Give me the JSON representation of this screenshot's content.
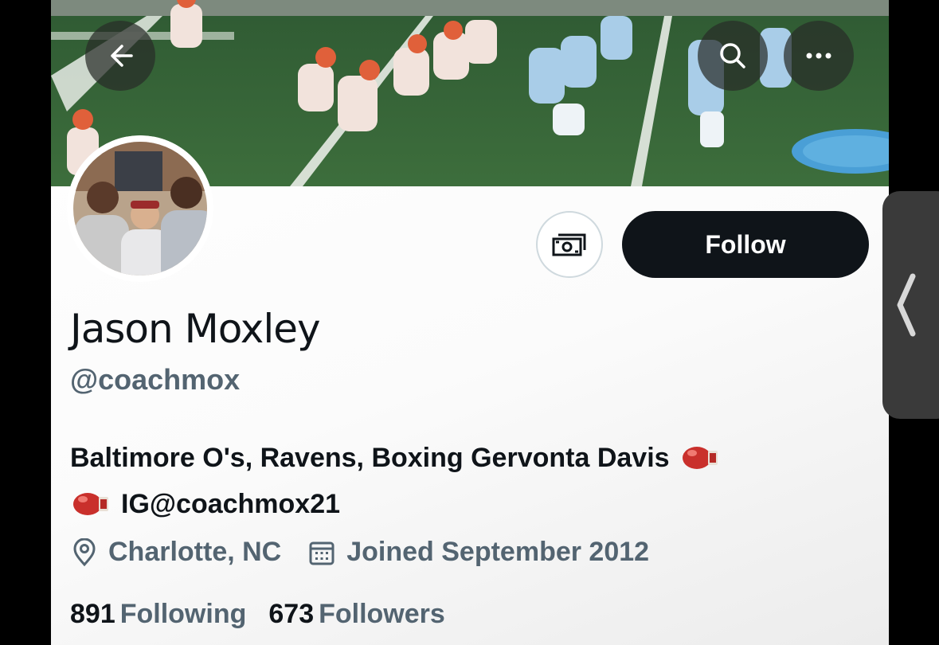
{
  "header": {
    "back_icon": "arrow-left-icon",
    "search_icon": "search-icon",
    "more_icon": "more-horizontal-icon"
  },
  "profile": {
    "name": "Jason Moxley",
    "handle": "@coachmox",
    "bio_line1": "Baltimore O's, Ravens, Boxing Gervonta Davis",
    "bio_line2": "IG@coachmox21",
    "location": "Charlotte, NC",
    "joined": "Joined September 2012",
    "following_count": "891",
    "following_label": "Following",
    "followers_count": "673",
    "followers_label": "Followers"
  },
  "actions": {
    "tip_icon": "money-icon",
    "follow_label": "Follow"
  },
  "colors": {
    "primary_text": "#0f1419",
    "secondary_text": "#536471",
    "follow_bg": "#0f1419"
  }
}
